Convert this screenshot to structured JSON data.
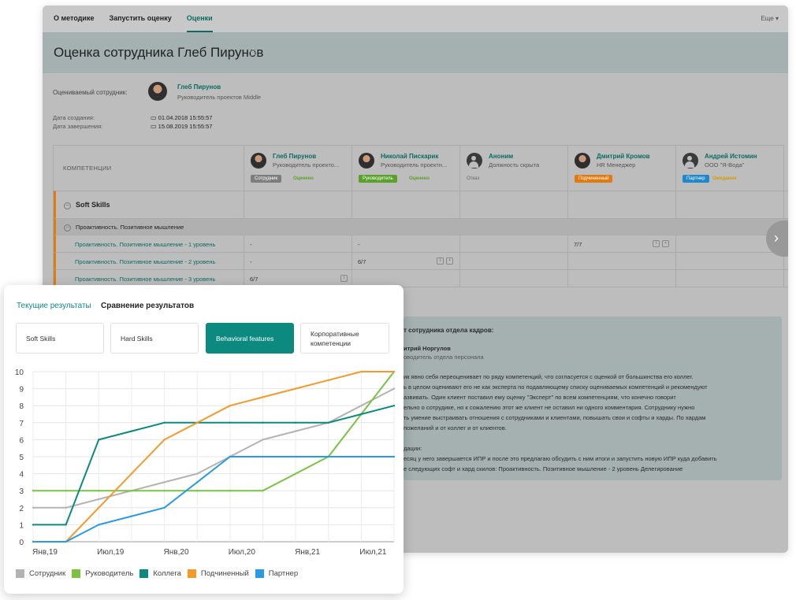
{
  "nav": {
    "tabs": [
      "О методике",
      "Запустить оценку",
      "Оценки"
    ],
    "more": "Еще"
  },
  "title": "Оценка сотрудника Глеб Пирунов",
  "employee": {
    "label": "Оцениваемый сотрудник:",
    "name": "Глеб Пирунов",
    "role": "Руководитель проектов Middle"
  },
  "dates": {
    "created_label": "Дата создания:",
    "created": "01.04.2018 15:55:57",
    "finished_label": "Дата завершения:",
    "finished": "15.08.2019 15:55:57"
  },
  "table": {
    "competencies_header": "КОМПЕТЕНЦИИ",
    "assessors": [
      {
        "name": "Глеб Пирунов",
        "role": "Руководитель проекто...",
        "badge": "Сотрудник",
        "badge_color": "#7d7d7d",
        "status": "Оценено",
        "status_color": "#5aa02c"
      },
      {
        "name": "Николай Пискарик",
        "role": "Руководитель проектн...",
        "badge": "Руководитель",
        "badge_color": "#5aa02c",
        "status": "Оценено",
        "status_color": "#5aa02c"
      },
      {
        "name": "Аноним",
        "role": "Должность скрыта",
        "badge": "",
        "status": "Отказ",
        "status_color": "#666"
      },
      {
        "name": "Дмитрий Кромов",
        "role": "HR Менеджер",
        "badge": "Подчиненный",
        "badge_color": "#e07b12",
        "status": "",
        "status_color": "#666"
      },
      {
        "name": "Андрей Истомин",
        "role": "ООО \"Я-Вода\"",
        "badge": "Партнер",
        "badge_color": "#1e88c9",
        "status": "Ожидание",
        "status_color": "#d89a00"
      }
    ],
    "group": "Soft Skills",
    "subgroup": "Проактивность. Позитивное мышление",
    "rows": [
      {
        "label": "Проактивность. Позитивное мышление - 1 уровень",
        "v1": "-",
        "v2": "-",
        "v4": "7/7"
      },
      {
        "label": "Проактивность. Позитивное мышление - 2 уровень",
        "v1": "-",
        "v2": "6/7"
      },
      {
        "label": "Проактивность. Позитивное мышление - 3 уровень",
        "v1": "6/7"
      }
    ]
  },
  "review": {
    "heading": "т сотрудника отдела кадров:",
    "author": "итрий Норгулов",
    "author_role": "оводитель отдела персонала",
    "lines": [
      "ик явно себя переоценивает по ряду компетенций, что согласуется с оценкой от большинства его коллег.",
      "ь в целом оценивают его не как эксперта по подавляющему списку оцениваемых компетенций и рекомендуют",
      "азвивать. Один клиент поставил ему оценку \"Эксперт\" по всем компетенциям, что конечно говорит",
      "ельно о сотрудике, но к сожалению этот же клиент не оставил ни одного комментария. Сотруднику нужно",
      "ть умение выстраивать отношения с сотрудниками и клиентами, повышать свои и софты и харды. По хардам",
      " пожеланий и от коллег и от клиентов."
    ],
    "rec_heading": "дации:",
    "rec_lines": [
      "есяц у него завершается ИПР и после это предлагаю обсудить с ним итоги и запустить новую ИПР куда добавить",
      "е следующих софт и хард скилов: Проактивность. Позитивное мышление - 2 уровень  Делегирование"
    ]
  },
  "panel": {
    "tab_current": "Текущие результаты",
    "tab_compare": "Сравнение результатов",
    "categories": [
      "Soft Skills",
      "Hard Skills",
      "Behavioral features",
      "Корпоративные компетенции"
    ],
    "active_category": 2
  },
  "chart_data": {
    "type": "line",
    "x": [
      "Янв,19",
      "Апр,19",
      "Июл,19",
      "Окт,19",
      "Янв,20",
      "Апр,20",
      "Июл,20",
      "Окт,20",
      "Янв,21",
      "Апр,21",
      "Июл,21",
      "Окт,21"
    ],
    "x_tick_labels": [
      "Янв,19",
      "Июл,19",
      "Янв,20",
      "Июл,20",
      "Янв,21",
      "Июл,21"
    ],
    "ylim": [
      0,
      10
    ],
    "yticks": [
      0,
      1,
      2,
      3,
      4,
      5,
      6,
      7,
      8,
      9,
      10
    ],
    "grid": true,
    "legend": "bottom",
    "series": [
      {
        "name": "Сотрудник",
        "color": "#b3b3b3",
        "values": [
          2,
          2,
          2.5,
          3,
          3.5,
          4,
          5,
          6,
          6.5,
          7,
          8,
          9
        ]
      },
      {
        "name": "Руководитель",
        "color": "#7cc242",
        "values": [
          3,
          3,
          3,
          3,
          3,
          3,
          3,
          3,
          4,
          5,
          7.5,
          10
        ]
      },
      {
        "name": "Коллега",
        "color": "#0c8a80",
        "values": [
          1,
          1,
          6,
          6.5,
          7,
          7,
          7,
          7,
          7,
          7,
          7.5,
          8
        ]
      },
      {
        "name": "Подчиненный",
        "color": "#f39a2b",
        "values": [
          0,
          0,
          2,
          4,
          6,
          7,
          8,
          8.5,
          9,
          9.5,
          10,
          10
        ]
      },
      {
        "name": "Партнер",
        "color": "#2a9be0",
        "values": [
          0,
          0,
          1,
          1.5,
          2,
          3.5,
          5,
          5,
          5,
          5,
          5,
          5
        ]
      }
    ]
  }
}
